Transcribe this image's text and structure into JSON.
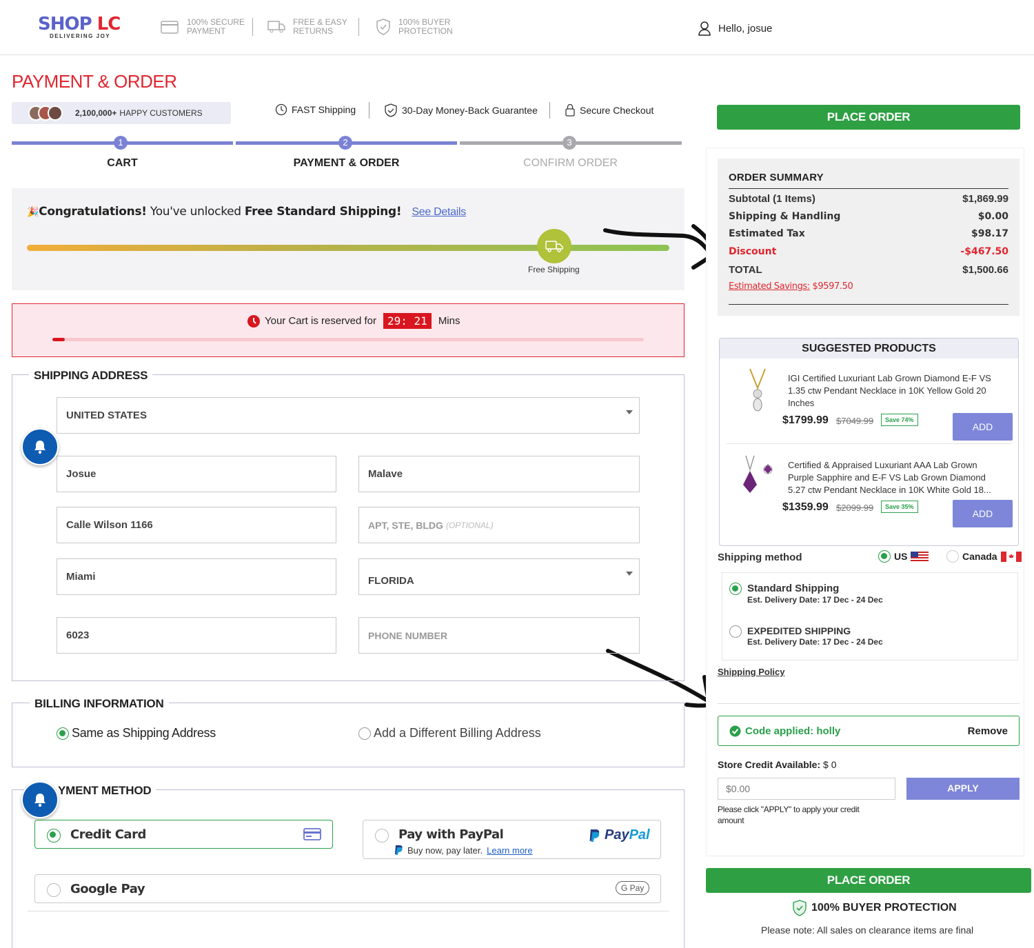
{
  "header": {
    "logo": {
      "shop": "SH",
      "op": "OP",
      "lc": "LC",
      "tagline": "DELIVERING JOY"
    },
    "features": [
      {
        "icon": "credit-card-icon",
        "line1": "100% SECURE",
        "line2": "PAYMENT"
      },
      {
        "icon": "truck-return-icon",
        "line1": "FREE & EASY",
        "line2": "RETURNS"
      },
      {
        "icon": "shield-check-icon",
        "line1": "100% BUYER",
        "line2": "PROTECTION"
      }
    ],
    "greeting": "Hello, josue"
  },
  "page_title": "PAYMENT & ORDER",
  "happy_customers": {
    "count": "2,100,000+",
    "label": "HAPPY CUSTOMERS"
  },
  "guarantees": [
    "FAST Shipping",
    "30-Day Money-Back Guarantee",
    "Secure Checkout"
  ],
  "stepper": {
    "steps": [
      {
        "num": "1",
        "label": "CART",
        "state": "done"
      },
      {
        "num": "2",
        "label": "PAYMENT & ORDER",
        "state": "current"
      },
      {
        "num": "3",
        "label": "CONFIRM ORDER",
        "state": "todo"
      }
    ],
    "colors": {
      "active": "#7b82d4",
      "inactive": "#a9a9ad"
    }
  },
  "shipping_banner": {
    "emoji": "🎉",
    "bold1": "Congratulations!",
    "mid": " You've unlocked ",
    "bold2": "Free Standard Shipping!",
    "link": "See Details",
    "milestone_label": "Free Shipping"
  },
  "reservation": {
    "prefix": "Your Cart is reserved for",
    "time": "29: 21",
    "unit": "Mins"
  },
  "shipping_address": {
    "legend": "SHIPPING ADDRESS",
    "country": "UNITED STATES",
    "first_name": "Josue",
    "last_name": "Malave",
    "address1": "Calle Wilson 1166",
    "address2_placeholder": "APT, STE, BLDG",
    "address2_optional": "(OPTIONAL)",
    "city": "Miami",
    "state": "FLORIDA",
    "zip": "6023",
    "phone_placeholder": "PHONE NUMBER"
  },
  "billing": {
    "legend": "BILLING INFORMATION",
    "option_same": "Same as Shipping Address",
    "option_diff": "Add a Different Billing Address"
  },
  "payment": {
    "legend": "YMENT METHOD",
    "credit_card": "Credit Card",
    "paypal_title": "Pay with PayPal",
    "paypal_sub": "Buy now, pay later.",
    "paypal_link": "Learn more",
    "paypal_logo_a": "Pay",
    "paypal_logo_b": "Pal",
    "google_pay": "Google Pay",
    "gpay_badge": "G Pay"
  },
  "order": {
    "place_order": "PLACE ORDER",
    "summary_title": "ORDER SUMMARY",
    "rows": [
      {
        "label": "Subtotal (1 Items)",
        "value": "$1,869.99"
      },
      {
        "label": "Shipping & Handling",
        "value": "$0.00"
      },
      {
        "label": "Estimated Tax",
        "value": "$98.17"
      },
      {
        "label": "Discount",
        "value": "-$467.50"
      },
      {
        "label": "TOTAL",
        "value": "$1,500.66"
      }
    ],
    "savings_label": "Estimated Savings:",
    "savings_value": "$9597.50"
  },
  "suggested": {
    "title": "SUGGESTED PRODUCTS",
    "items": [
      {
        "name": "IGI Certified Luxuriant Lab Grown Diamond E-F VS 1.35 ctw Pendant Necklace in 10K Yellow Gold 20 Inches",
        "price": "$1799.99",
        "old": "$7049.99",
        "save": "Save 74%",
        "add": "ADD"
      },
      {
        "name": "Certified & Appraised Luxuriant AAA Lab Grown Purple Sapphire and E-F VS Lab Grown Diamond 5.27 ctw Pendant Necklace in 10K White Gold 18...",
        "price": "$1359.99",
        "old": "$2099.99",
        "save": "Save 35%",
        "add": "ADD"
      }
    ]
  },
  "shipping_method": {
    "label": "Shipping method",
    "us": "US",
    "canada": "Canada",
    "options": [
      {
        "name": "Standard Shipping",
        "date": "Est. Delivery Date: 17 Dec - 24 Dec"
      },
      {
        "name": "EXPEDITED SHIPPING",
        "date": "Est. Delivery Date: 17 Dec - 24 Dec"
      }
    ],
    "policy": "Shipping Policy"
  },
  "promo": {
    "applied": "Code applied: holly",
    "remove": "Remove"
  },
  "store_credit": {
    "label": "Store Credit Available:",
    "value": "$ 0",
    "input_value": "$0.00",
    "apply": "APPLY",
    "note": "Please click \"APPLY\" to apply your credit amount"
  },
  "footer": {
    "place_order": "PLACE ORDER",
    "protection": "100% BUYER PROTECTION",
    "note": "Please note: All sales on clearance items are final"
  }
}
